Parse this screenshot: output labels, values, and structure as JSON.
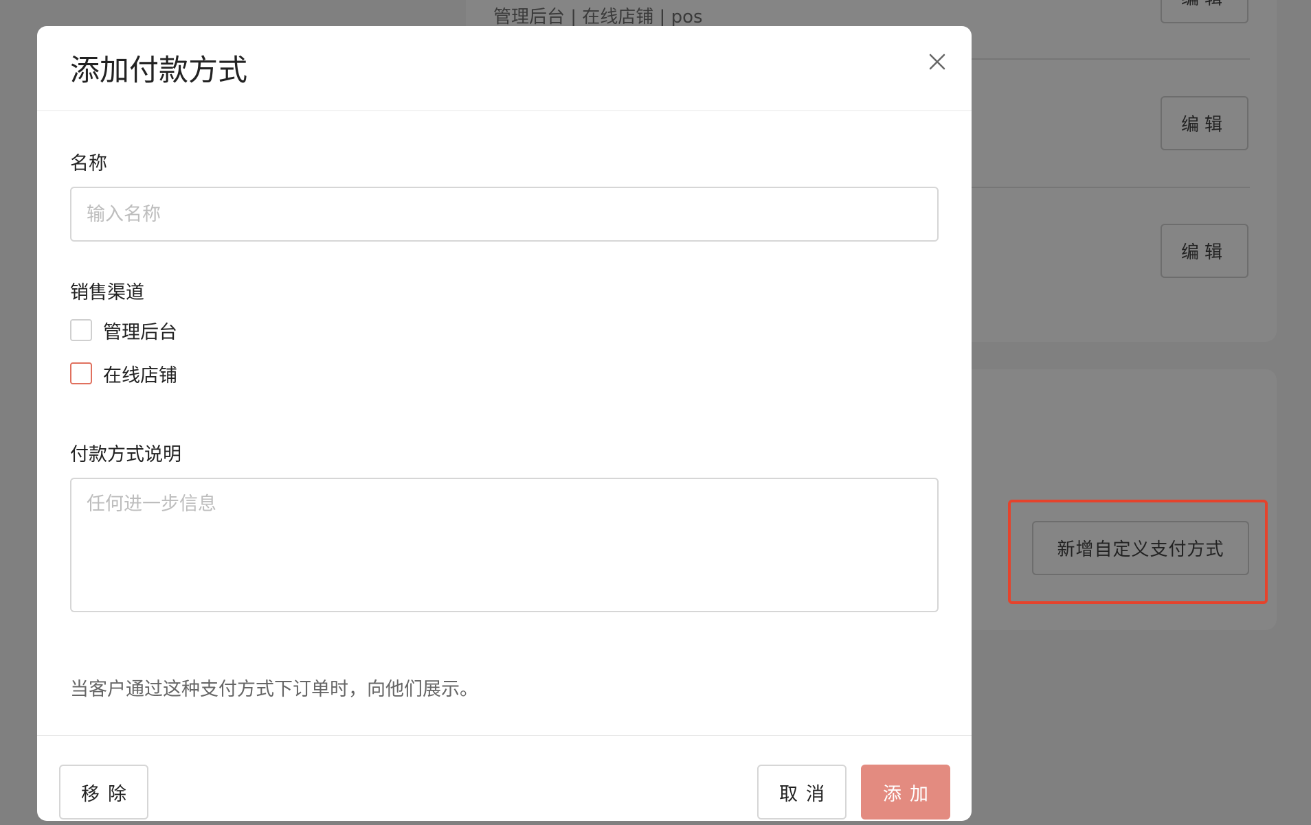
{
  "background": {
    "row_text": "管理后台 | 在线店铺 | pos",
    "edit_buttons": [
      "编辑",
      "编辑",
      "编辑"
    ],
    "add_custom_payment_button": "新增自定义支付方式",
    "highlight_color": "#e5432c"
  },
  "modal": {
    "title": "添加付款方式",
    "close_icon": "close-icon",
    "name_field": {
      "label": "名称",
      "placeholder": "输入名称",
      "value": ""
    },
    "sales_channels": {
      "label": "销售渠道",
      "options": [
        {
          "label": "管理后台",
          "checked": false
        },
        {
          "label": "在线店铺",
          "checked": false
        }
      ]
    },
    "description_field": {
      "label": "付款方式说明",
      "placeholder": "任何进一步信息",
      "value": ""
    },
    "help_text": "当客户通过这种支付方式下订单时，向他们展示。",
    "footer": {
      "remove_label": "移除",
      "cancel_label": "取消",
      "add_label": "添加"
    },
    "colors": {
      "primary_button": "#e38b80",
      "focus_border": "#e0705e"
    }
  }
}
